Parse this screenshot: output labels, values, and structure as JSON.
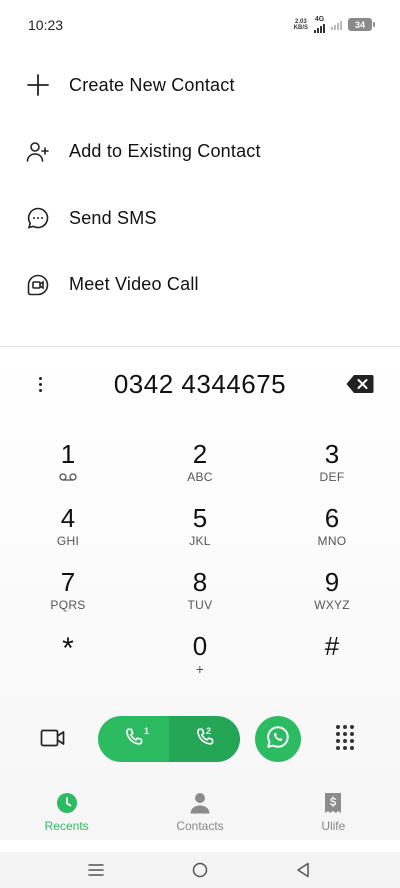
{
  "status_bar": {
    "time": "10:23",
    "net_speed_value": "2.03",
    "net_speed_unit": "KB/S",
    "network_type": "4G",
    "battery": "34"
  },
  "menu": {
    "items": [
      {
        "label": "Create New Contact",
        "icon": "plus-icon"
      },
      {
        "label": "Add to Existing Contact",
        "icon": "add-person-icon"
      },
      {
        "label": "Send SMS",
        "icon": "sms-bubble-icon"
      },
      {
        "label": "Meet Video Call",
        "icon": "meet-video-icon"
      }
    ]
  },
  "dialer": {
    "number": "0342 4344675",
    "keys": [
      {
        "digit": "1",
        "letters": ""
      },
      {
        "digit": "2",
        "letters": "ABC"
      },
      {
        "digit": "3",
        "letters": "DEF"
      },
      {
        "digit": "4",
        "letters": "GHI"
      },
      {
        "digit": "5",
        "letters": "JKL"
      },
      {
        "digit": "6",
        "letters": "MNO"
      },
      {
        "digit": "7",
        "letters": "PQRS"
      },
      {
        "digit": "8",
        "letters": "TUV"
      },
      {
        "digit": "9",
        "letters": "WXYZ"
      },
      {
        "digit": "*",
        "letters": ""
      },
      {
        "digit": "0",
        "letters": "+"
      },
      {
        "digit": "#",
        "letters": ""
      }
    ],
    "sim1_label": "1",
    "sim2_label": "2"
  },
  "bottom_nav": {
    "recents": "Recents",
    "contacts": "Contacts",
    "ulife": "Ulife"
  },
  "colors": {
    "accent": "#2dbb62",
    "accent_dark": "#25a556"
  }
}
